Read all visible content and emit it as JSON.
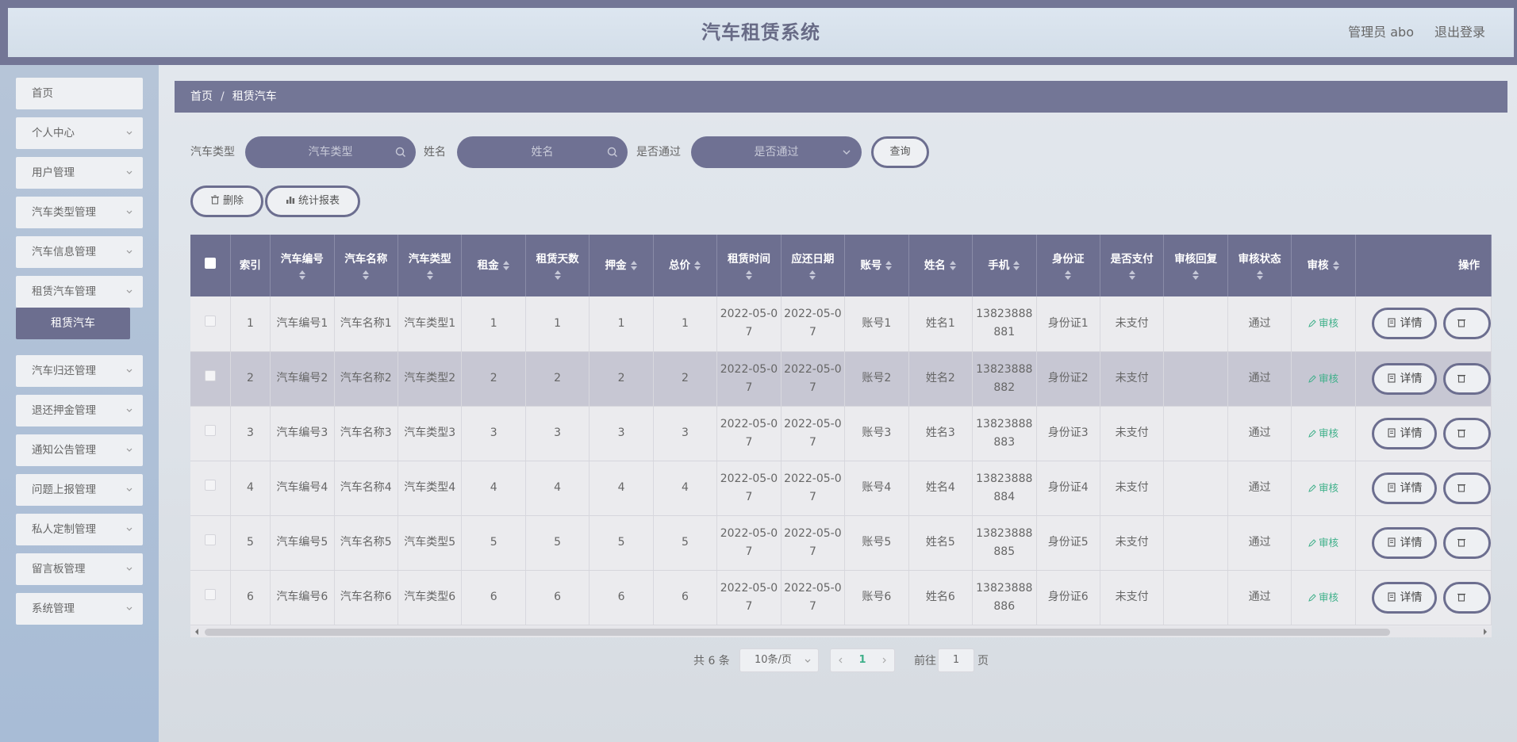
{
  "header": {
    "title": "汽车租赁系统",
    "admin": "管理员 abo",
    "logout": "退出登录"
  },
  "sidebar": {
    "items": [
      {
        "label": "首页",
        "has_arrow": false
      },
      {
        "label": "个人中心",
        "has_arrow": true
      },
      {
        "label": "用户管理",
        "has_arrow": true
      },
      {
        "label": "汽车类型管理",
        "has_arrow": true
      },
      {
        "label": "汽车信息管理",
        "has_arrow": true
      },
      {
        "label": "租赁汽车管理",
        "has_arrow": true
      },
      {
        "label": "汽车归还管理",
        "has_arrow": true
      },
      {
        "label": "退还押金管理",
        "has_arrow": true
      },
      {
        "label": "通知公告管理",
        "has_arrow": true
      },
      {
        "label": "问题上报管理",
        "has_arrow": true
      },
      {
        "label": "私人定制管理",
        "has_arrow": true
      },
      {
        "label": "留言板管理",
        "has_arrow": true
      },
      {
        "label": "系统管理",
        "has_arrow": true
      }
    ],
    "submenu_active": "租赁汽车"
  },
  "breadcrumb": {
    "home": "首页",
    "separator": "/",
    "current": "租赁汽车"
  },
  "search": {
    "car_type_label": "汽车类型",
    "car_type_placeholder": "汽车类型",
    "name_label": "姓名",
    "name_placeholder": "姓名",
    "approved_label": "是否通过",
    "approved_placeholder": "是否通过",
    "query_button": "查询"
  },
  "toolbar": {
    "delete_button": "删除",
    "report_button": "统计报表"
  },
  "table": {
    "columns": [
      "索引",
      "汽车编号",
      "汽车名称",
      "汽车类型",
      "租金",
      "租赁天数",
      "押金",
      "总价",
      "租赁时间",
      "应还日期",
      "账号",
      "姓名",
      "手机",
      "身份证",
      "是否支付",
      "审核回复",
      "审核状态",
      "审核",
      "操作"
    ],
    "rows": [
      {
        "index": "1",
        "car_no": "汽车编号1",
        "car_name": "汽车名称1",
        "car_type": "汽车类型1",
        "rent": "1",
        "days": "1",
        "deposit": "1",
        "total": "1",
        "rent_date": "2022-05-07",
        "due_date": "2022-05-07",
        "account": "账号1",
        "name": "姓名1",
        "phone": "13823888881",
        "id_card": "身份证1",
        "paid": "未支付",
        "reply": "",
        "status": "通过",
        "audit": "审核",
        "detail": "详情",
        "highlight": false
      },
      {
        "index": "2",
        "car_no": "汽车编号2",
        "car_name": "汽车名称2",
        "car_type": "汽车类型2",
        "rent": "2",
        "days": "2",
        "deposit": "2",
        "total": "2",
        "rent_date": "2022-05-07",
        "due_date": "2022-05-07",
        "account": "账号2",
        "name": "姓名2",
        "phone": "13823888882",
        "id_card": "身份证2",
        "paid": "未支付",
        "reply": "",
        "status": "通过",
        "audit": "审核",
        "detail": "详情",
        "highlight": true
      },
      {
        "index": "3",
        "car_no": "汽车编号3",
        "car_name": "汽车名称3",
        "car_type": "汽车类型3",
        "rent": "3",
        "days": "3",
        "deposit": "3",
        "total": "3",
        "rent_date": "2022-05-07",
        "due_date": "2022-05-07",
        "account": "账号3",
        "name": "姓名3",
        "phone": "13823888883",
        "id_card": "身份证3",
        "paid": "未支付",
        "reply": "",
        "status": "通过",
        "audit": "审核",
        "detail": "详情",
        "highlight": false
      },
      {
        "index": "4",
        "car_no": "汽车编号4",
        "car_name": "汽车名称4",
        "car_type": "汽车类型4",
        "rent": "4",
        "days": "4",
        "deposit": "4",
        "total": "4",
        "rent_date": "2022-05-07",
        "due_date": "2022-05-07",
        "account": "账号4",
        "name": "姓名4",
        "phone": "13823888884",
        "id_card": "身份证4",
        "paid": "未支付",
        "reply": "",
        "status": "通过",
        "audit": "审核",
        "detail": "详情",
        "highlight": false
      },
      {
        "index": "5",
        "car_no": "汽车编号5",
        "car_name": "汽车名称5",
        "car_type": "汽车类型5",
        "rent": "5",
        "days": "5",
        "deposit": "5",
        "total": "5",
        "rent_date": "2022-05-07",
        "due_date": "2022-05-07",
        "account": "账号5",
        "name": "姓名5",
        "phone": "13823888885",
        "id_card": "身份证5",
        "paid": "未支付",
        "reply": "",
        "status": "通过",
        "audit": "审核",
        "detail": "详情",
        "highlight": false
      },
      {
        "index": "6",
        "car_no": "汽车编号6",
        "car_name": "汽车名称6",
        "car_type": "汽车类型6",
        "rent": "6",
        "days": "6",
        "deposit": "6",
        "total": "6",
        "rent_date": "2022-05-07",
        "due_date": "2022-05-07",
        "account": "账号6",
        "name": "姓名6",
        "phone": "13823888886",
        "id_card": "身份证6",
        "paid": "未支付",
        "reply": "",
        "status": "通过",
        "audit": "审核",
        "detail": "详情",
        "highlight": false
      }
    ]
  },
  "pagination": {
    "total": "共 6 条",
    "page_size": "10条/页",
    "current_page": "1",
    "goto_label": "前往",
    "goto_value": "1",
    "page_suffix": "页"
  },
  "colors": {
    "accent": "#6d6f90",
    "audit_green": "#3fb08a"
  }
}
